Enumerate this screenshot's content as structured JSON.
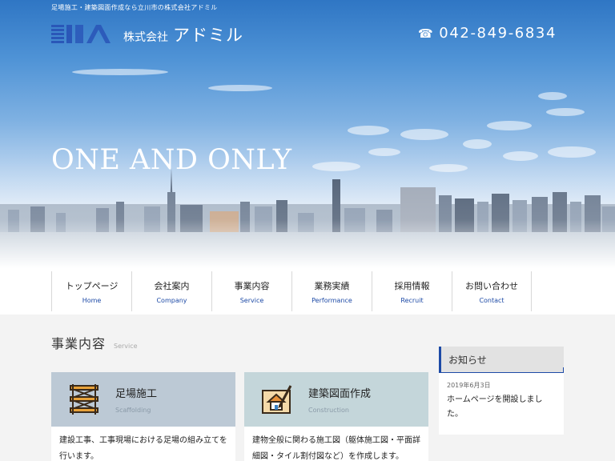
{
  "header": {
    "tagline": "足場施工・建築図面作成なら立川市の株式会社アドミル",
    "logo_corp": "株式会社",
    "logo_name": "アドミル",
    "phone_icon": "☎",
    "phone": "042-849-6834"
  },
  "hero": {
    "title": "ONE AND ONLY"
  },
  "nav": {
    "items": [
      {
        "ja": "トップページ",
        "en": "Home"
      },
      {
        "ja": "会社案内",
        "en": "Company"
      },
      {
        "ja": "事業内容",
        "en": "Service"
      },
      {
        "ja": "業務実績",
        "en": "Performance"
      },
      {
        "ja": "採用情報",
        "en": "Recruit"
      },
      {
        "ja": "お問い合わせ",
        "en": "Contact"
      }
    ]
  },
  "main": {
    "section_title": "事業内容",
    "section_subtitle": "Service",
    "cards": [
      {
        "title": "足場施工",
        "subtitle": "Scaffolding",
        "icon": "scaffold-icon",
        "body": "建設工事、工事現場における足場の組み立てを行います。"
      },
      {
        "title": "建築図面作成",
        "subtitle": "Construction",
        "icon": "blueprint-icon",
        "body": "建物全般に関わる施工図（躯体施工図・平面詳細図・タイル割付図など）を作成します。"
      }
    ]
  },
  "news": {
    "title": "お知らせ",
    "date": "2019年6月3日",
    "text": "ホームページを開設しました。"
  },
  "colors": {
    "accent": "#1d4aa6",
    "card1_head": "#bcc9d5",
    "card2_head": "#c4d6da"
  }
}
